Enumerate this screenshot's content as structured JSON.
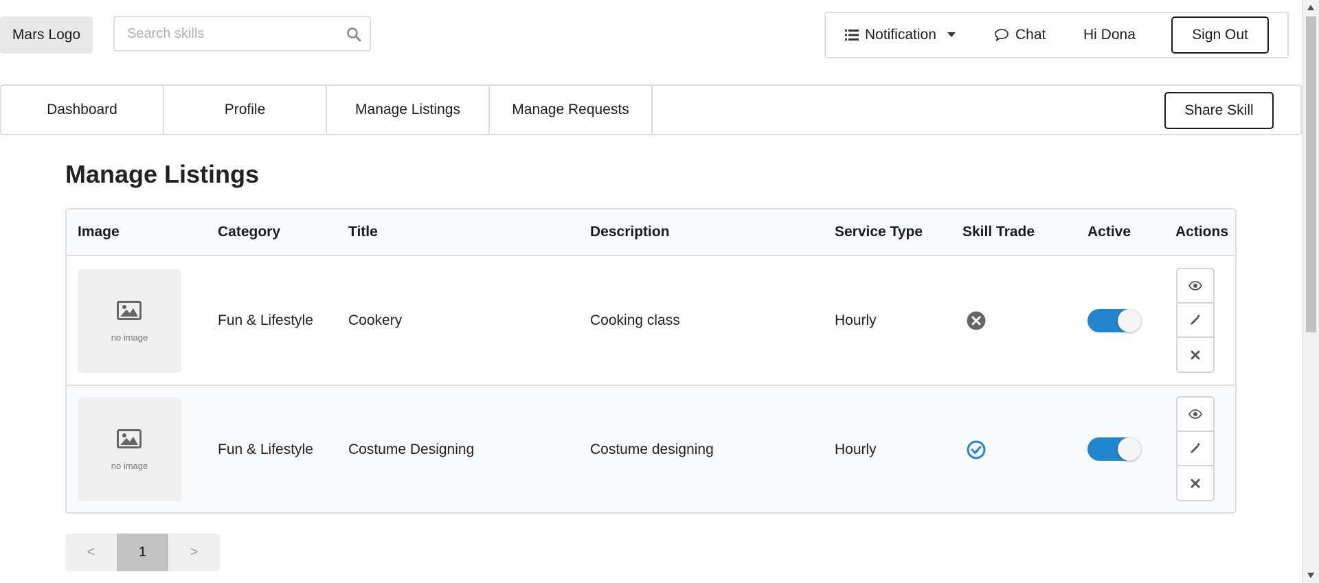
{
  "header": {
    "logo": "Mars Logo",
    "search_placeholder": "Search skills",
    "notification_label": "Notification",
    "chat_label": "Chat",
    "greeting": "Hi Dona",
    "signout_label": "Sign Out"
  },
  "nav": {
    "tabs": [
      "Dashboard",
      "Profile",
      "Manage Listings",
      "Manage Requests"
    ],
    "share_label": "Share Skill"
  },
  "page": {
    "title": "Manage Listings"
  },
  "table": {
    "columns": [
      "Image",
      "Category",
      "Title",
      "Description",
      "Service Type",
      "Skill Trade",
      "Active",
      "Actions"
    ],
    "rows": [
      {
        "image_caption": "no image",
        "category": "Fun & Lifestyle",
        "title": "Cookery",
        "description": "Cooking class",
        "service_type": "Hourly",
        "skill_trade": "x-circle-icon",
        "active": true
      },
      {
        "image_caption": "no image",
        "category": "Fun & Lifestyle",
        "title": "Costume Designing",
        "description": "Costume designing",
        "service_type": "Hourly",
        "skill_trade": "check-circle-icon",
        "active": true
      }
    ]
  },
  "pagination": {
    "prev": "<",
    "current": "1",
    "next": ">"
  },
  "colors": {
    "accent": "#2185d0",
    "icon_gray": "#777777"
  }
}
